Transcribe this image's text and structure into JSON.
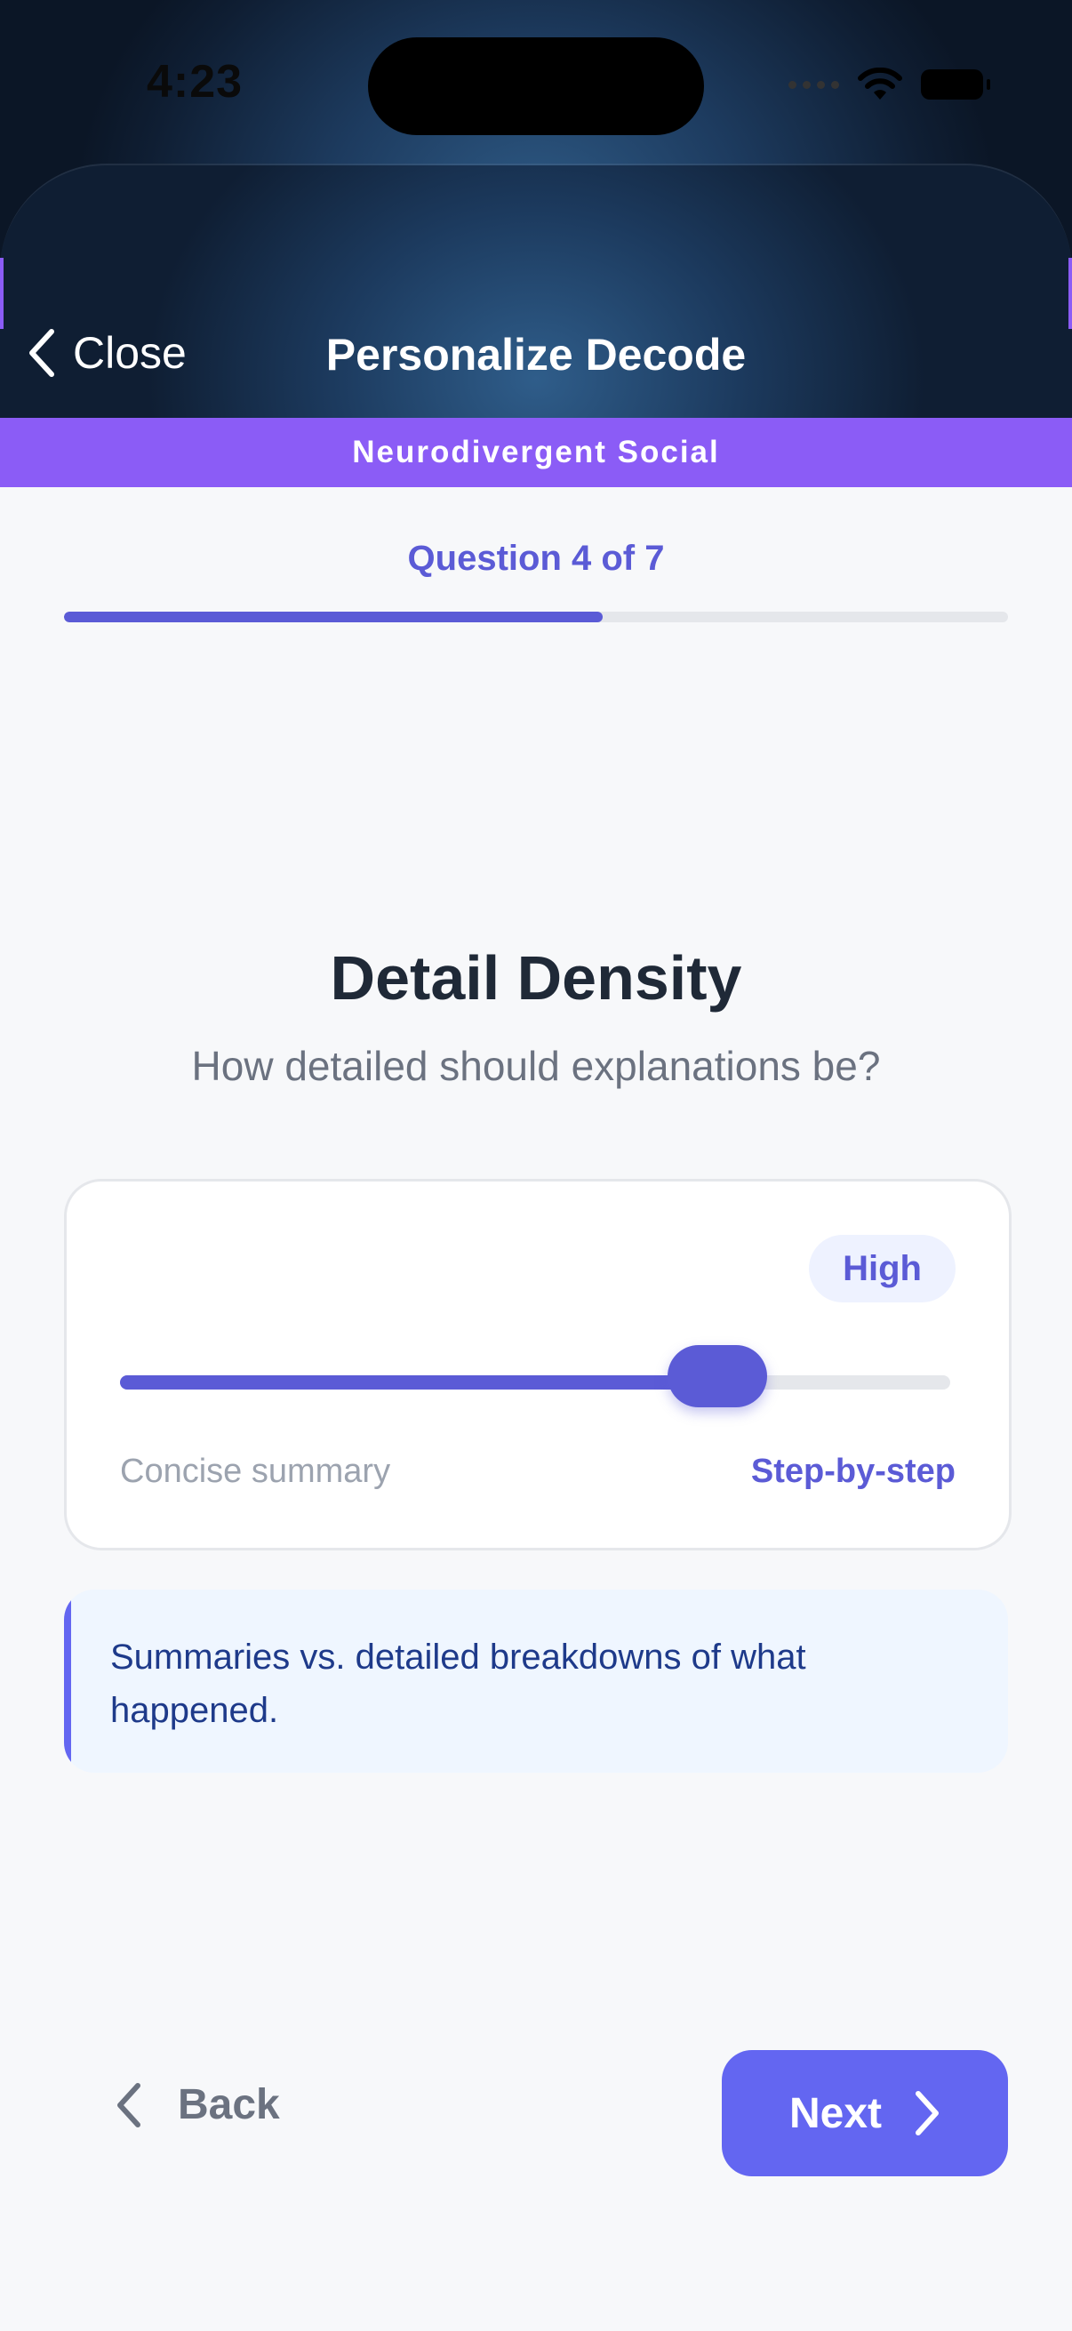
{
  "status_bar": {
    "time": "4:23",
    "icons": [
      "cellular-signal-icon",
      "wifi-icon",
      "battery-icon"
    ]
  },
  "nav": {
    "close_label": "Close",
    "title": "Personalize Decode"
  },
  "category": {
    "label": "Neurodivergent Social",
    "color": "#8b5cf6"
  },
  "progress": {
    "label": "Question 4 of 7",
    "current": 4,
    "total": 7,
    "fraction": 0.571
  },
  "question": {
    "title": "Detail Density",
    "subtitle": "How detailed should explanations be?"
  },
  "slider": {
    "level_label": "High",
    "min_label": "Concise summary",
    "max_label": "Step-by-step",
    "value_fraction": 0.72
  },
  "hint": {
    "text": "Summaries vs. detailed breakdowns of what happened."
  },
  "footer": {
    "back_label": "Back",
    "next_label": "Next"
  },
  "colors": {
    "accent": "#6366f1",
    "accent_text": "#5b5bd6",
    "header_dark": "#0f1e33"
  }
}
